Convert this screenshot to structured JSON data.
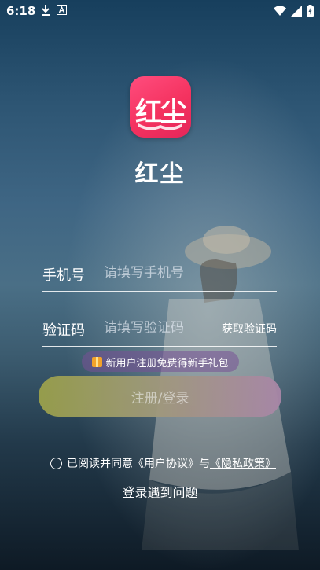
{
  "status": {
    "time": "6:18",
    "left_icons": [
      "download-icon",
      "font-icon"
    ],
    "right_icons": [
      "wifi-icon",
      "signal-icon",
      "battery-icon"
    ]
  },
  "app": {
    "logo_text": "红尘",
    "name": "红尘"
  },
  "form": {
    "phone_label": "手机号",
    "phone_placeholder": "请填写手机号",
    "code_label": "验证码",
    "code_placeholder": "请填写验证码",
    "get_code": "获取验证码"
  },
  "promo": {
    "text": "新用户注册免费得新手礼包",
    "icon": "gift-icon"
  },
  "login_button": "注册/登录",
  "agreement": {
    "prefix": "已阅读并同意",
    "user_agreement": "《用户协议》",
    "and": "与",
    "privacy": "《隐私政策》"
  },
  "help_link": "登录遇到问题",
  "colors": {
    "brand": "#f4325f",
    "button_start": "#9aa04a",
    "button_end": "#a886a7"
  }
}
